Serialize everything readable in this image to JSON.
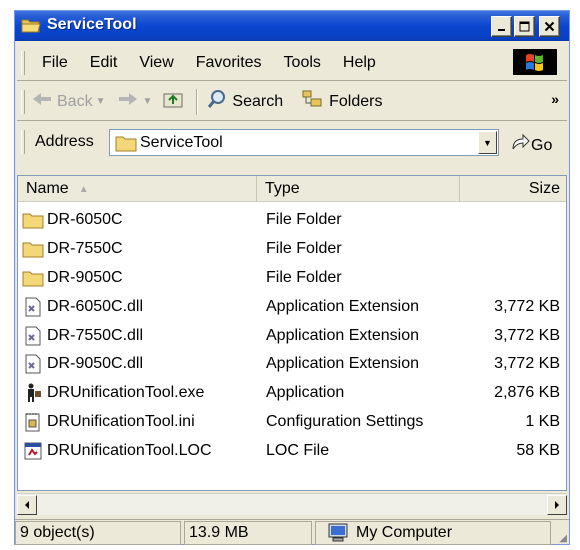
{
  "window": {
    "title": "ServiceTool",
    "title_icon": "folder-open-icon",
    "buttons": {
      "minimize": "_",
      "maximize": "□",
      "close": "✕"
    }
  },
  "menu": {
    "items": [
      {
        "label": "File"
      },
      {
        "label": "Edit"
      },
      {
        "label": "View"
      },
      {
        "label": "Favorites"
      },
      {
        "label": "Tools"
      },
      {
        "label": "Help"
      }
    ],
    "logo": "windows-logo-icon"
  },
  "toolbar": {
    "back_label": "Back",
    "search_label": "Search",
    "folders_label": "Folders",
    "more": "»"
  },
  "address": {
    "label": "Address",
    "value": "ServiceTool",
    "go_label": "Go"
  },
  "filelist": {
    "columns": {
      "name": "Name",
      "type": "Type",
      "size": "Size"
    },
    "rows": [
      {
        "name": "DR-6050C",
        "type": "File Folder",
        "size": "",
        "icon": "folder-icon"
      },
      {
        "name": "DR-7550C",
        "type": "File Folder",
        "size": "",
        "icon": "folder-icon"
      },
      {
        "name": "DR-9050C",
        "type": "File Folder",
        "size": "",
        "icon": "folder-icon"
      },
      {
        "name": "DR-6050C.dll",
        "type": "Application Extension",
        "size": "3,772 KB",
        "icon": "dll-file-icon"
      },
      {
        "name": "DR-7550C.dll",
        "type": "Application Extension",
        "size": "3,772 KB",
        "icon": "dll-file-icon"
      },
      {
        "name": "DR-9050C.dll",
        "type": "Application Extension",
        "size": "3,772 KB",
        "icon": "dll-file-icon"
      },
      {
        "name": "DRUnificationTool.exe",
        "type": "Application",
        "size": "2,876 KB",
        "icon": "exe-app-icon"
      },
      {
        "name": "DRUnificationTool.ini",
        "type": "Configuration Settings",
        "size": "1 KB",
        "icon": "ini-file-icon"
      },
      {
        "name": "DRUnificationTool.LOC",
        "type": "LOC File",
        "size": "58 KB",
        "icon": "loc-file-icon"
      }
    ]
  },
  "status": {
    "objects": "9 object(s)",
    "size": "13.9 MB",
    "location": "My Computer",
    "location_icon": "my-computer-icon"
  }
}
